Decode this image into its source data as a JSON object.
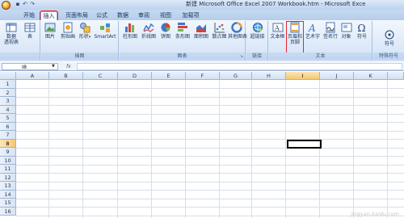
{
  "window": {
    "title": "新建 Microsoft Office Excel 2007 Workbook.htm - Microsoft Exce",
    "qat": [
      "save-icon",
      "undo-icon",
      "redo-icon"
    ]
  },
  "tabs": [
    {
      "label": "开始",
      "active": false
    },
    {
      "label": "插入",
      "active": true
    },
    {
      "label": "页面布局",
      "active": false
    },
    {
      "label": "公式",
      "active": false
    },
    {
      "label": "数据",
      "active": false
    },
    {
      "label": "审阅",
      "active": false
    },
    {
      "label": "视图",
      "active": false
    },
    {
      "label": "加载项",
      "active": false
    }
  ],
  "ribbon": {
    "groups": [
      {
        "label": "表",
        "buttons": [
          {
            "label": "数据\n透视表",
            "icon": "pivot-table-icon"
          },
          {
            "label": "表",
            "icon": "table-icon"
          }
        ]
      },
      {
        "label": "插图",
        "buttons": [
          {
            "label": "图片",
            "icon": "picture-icon"
          },
          {
            "label": "剪贴画",
            "icon": "clip-art-icon"
          },
          {
            "label": "形状",
            "icon": "shapes-icon"
          },
          {
            "label": "SmartArt",
            "icon": "smartart-icon"
          }
        ]
      },
      {
        "label": "图表",
        "buttons": [
          {
            "label": "柱形图",
            "icon": "column-chart-icon"
          },
          {
            "label": "折线图",
            "icon": "line-chart-icon"
          },
          {
            "label": "饼图",
            "icon": "pie-chart-icon"
          },
          {
            "label": "条形图",
            "icon": "bar-chart-icon"
          },
          {
            "label": "面积图",
            "icon": "area-chart-icon"
          },
          {
            "label": "散点图",
            "icon": "scatter-chart-icon"
          },
          {
            "label": "其他图表",
            "icon": "other-charts-icon"
          }
        ]
      },
      {
        "label": "链接",
        "buttons": [
          {
            "label": "超链接",
            "icon": "hyperlink-icon"
          }
        ]
      },
      {
        "label": "文本",
        "buttons": [
          {
            "label": "文本框",
            "icon": "text-box-icon"
          },
          {
            "label": "页眉和\n页脚",
            "icon": "header-footer-icon",
            "highlighted": true
          },
          {
            "label": "艺术字",
            "icon": "wordart-icon"
          },
          {
            "label": "签名行",
            "icon": "signature-line-icon"
          },
          {
            "label": "对象",
            "icon": "object-icon"
          },
          {
            "label": "符号",
            "icon": "omega-icon"
          }
        ]
      },
      {
        "label": "特殊符号",
        "buttons": [
          {
            "label": "符号",
            "icon": "special-symbol-icon"
          }
        ]
      }
    ]
  },
  "formula_bar": {
    "name_box": "I8",
    "fx": "fx",
    "value": ""
  },
  "sheet": {
    "columns": [
      "A",
      "B",
      "C",
      "D",
      "E",
      "F",
      "G",
      "H",
      "I",
      "J",
      "K"
    ],
    "rows": [
      "1",
      "2",
      "3",
      "4",
      "5",
      "6",
      "7",
      "8",
      "9",
      "10",
      "11",
      "12",
      "13",
      "14",
      "15",
      "16"
    ],
    "selected_column": "I",
    "selected_row": "8",
    "active_cell": "I8"
  },
  "watermark": "jingyan.baidu.com",
  "colors": {
    "highlight": "#e3262f",
    "ribbon_bg": "#dbe8f8",
    "header_selected": "#f5c772"
  }
}
